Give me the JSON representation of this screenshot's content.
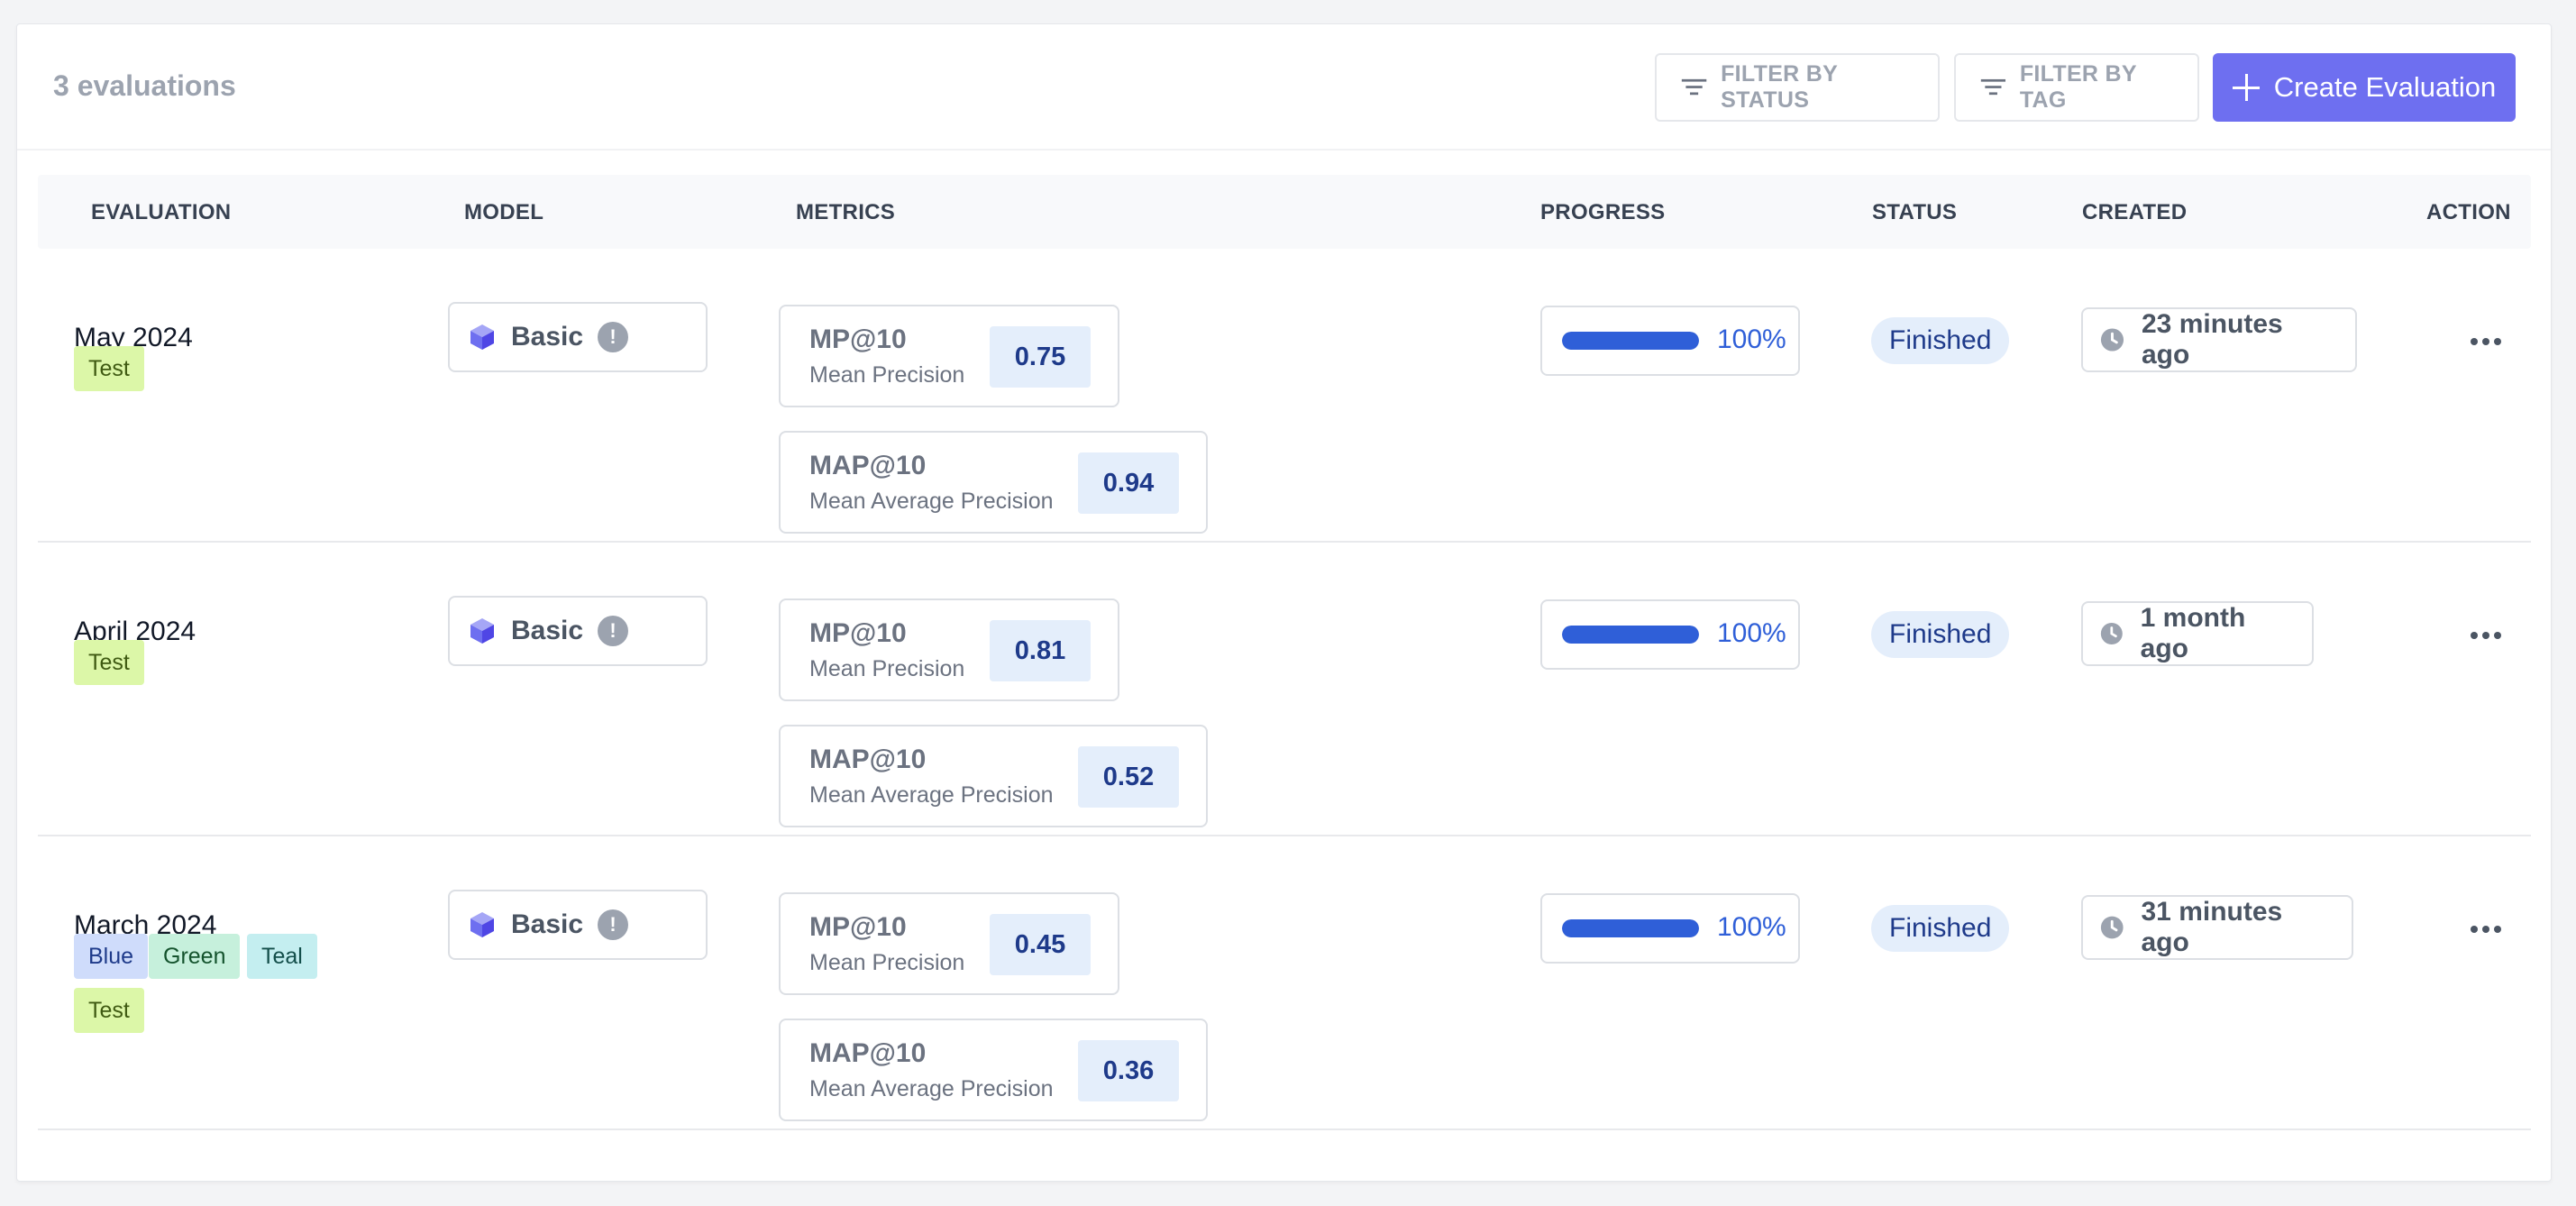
{
  "header": {
    "count_label": "3 evaluations",
    "filter_status_label": "FILTER BY STATUS",
    "filter_tag_label": "FILTER BY TAG",
    "create_label": "Create Evaluation"
  },
  "columns": {
    "evaluation": "EVALUATION",
    "model": "MODEL",
    "metrics": "METRICS",
    "progress": "PROGRESS",
    "status": "STATUS",
    "created": "CREATED",
    "action": "ACTION"
  },
  "rows": [
    {
      "name": "May 2024",
      "tags": [
        "Test"
      ],
      "model": "Basic",
      "metrics": [
        {
          "code": "MP@10",
          "desc": "Mean Precision",
          "value": "0.75"
        },
        {
          "code": "MAP@10",
          "desc": "Mean Average Precision",
          "value": "0.94"
        }
      ],
      "progress": 1.0,
      "progress_label": "100%",
      "status": "Finished",
      "created": "23 minutes ago"
    },
    {
      "name": "April 2024",
      "tags": [
        "Test"
      ],
      "model": "Basic",
      "metrics": [
        {
          "code": "MP@10",
          "desc": "Mean Precision",
          "value": "0.81"
        },
        {
          "code": "MAP@10",
          "desc": "Mean Average Precision",
          "value": "0.52"
        }
      ],
      "progress": 1.0,
      "progress_label": "100%",
      "status": "Finished",
      "created": "1 month ago"
    },
    {
      "name": "March 2024",
      "tags": [
        "Blue",
        "Green",
        "Teal",
        "Test"
      ],
      "model": "Basic",
      "metrics": [
        {
          "code": "MP@10",
          "desc": "Mean Precision",
          "value": "0.45"
        },
        {
          "code": "MAP@10",
          "desc": "Mean Average Precision",
          "value": "0.36"
        }
      ],
      "progress": 1.0,
      "progress_label": "100%",
      "status": "Finished",
      "created": "31 minutes ago"
    }
  ],
  "tag_colors": {
    "Test": {
      "bg": "#dcf7a8",
      "fg": "#3f5a12"
    },
    "Blue": {
      "bg": "#cfdcfb",
      "fg": "#1e3a8a"
    },
    "Green": {
      "bg": "#c6f0dc",
      "fg": "#14532d"
    },
    "Teal": {
      "bg": "#c4eef0",
      "fg": "#134e4a"
    }
  },
  "colors": {
    "accent": "#6e6ff0",
    "progress": "#2f5fd8",
    "badge_bg": "#e4eefb",
    "badge_fg": "#1e3a8a"
  },
  "icons": {
    "filter": "filter-icon",
    "plus": "plus-icon",
    "model": "cube-icon",
    "info": "info-icon",
    "clock": "clock-icon",
    "action": "more-horizontal-icon"
  }
}
